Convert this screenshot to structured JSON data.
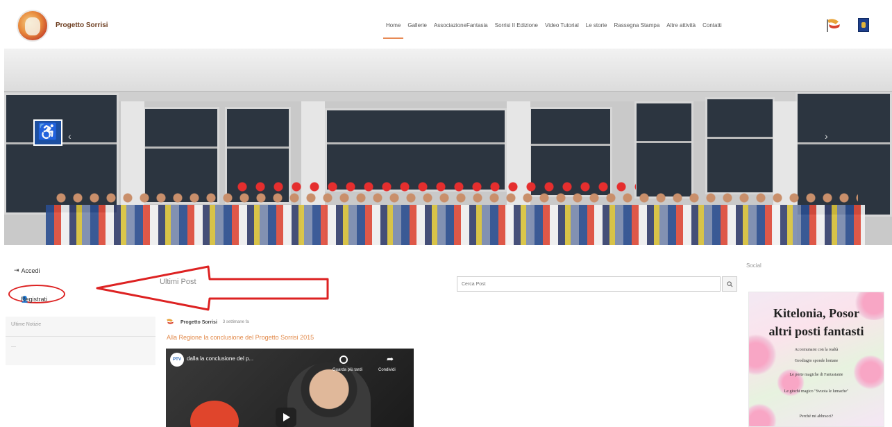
{
  "header": {
    "site_title": "Progetto Sorrisi",
    "nav": [
      "Home",
      "Gallerie",
      "AssociazioneFantasia",
      "Sorrisi II Edizione",
      "Video Tutorial",
      "Le storie",
      "Rassegna Stampa",
      "Altre attività",
      "Contatti"
    ]
  },
  "sidebar": {
    "accedi_label": "Accedi",
    "registrati_label": "Registrati",
    "box_line1": "Ultime Notizie",
    "box_line2": "—"
  },
  "main": {
    "section_title": "Ultimi Post",
    "search_placeholder": "Cerca Post",
    "post": {
      "author": "Progetto Sorrisi",
      "date": "3 settimane fa",
      "title": "Alla Regione la conclusione del Progetto Sorrisi 2015",
      "video_title": "dalla la conclusione del p...",
      "video_channel": "PTV",
      "watch_later": "Guarda più tardi",
      "share": "Condividi"
    }
  },
  "right": {
    "social_label": "Social",
    "poster": {
      "title_line1": "Kitelonia, Posor",
      "title_line2": "altri posti fantasti",
      "lines": [
        "Accomunarsi con la realtà",
        "Geodiagio sponde lontane",
        "Le porte magiche di Fantasianie",
        "Le giochi magico \"Svuota le lumache\"",
        "Perché mi abbracci?"
      ]
    }
  },
  "colors": {
    "accent": "#e78a55",
    "annotation_red": "#dd2222",
    "link_orange": "#e28a4b"
  }
}
